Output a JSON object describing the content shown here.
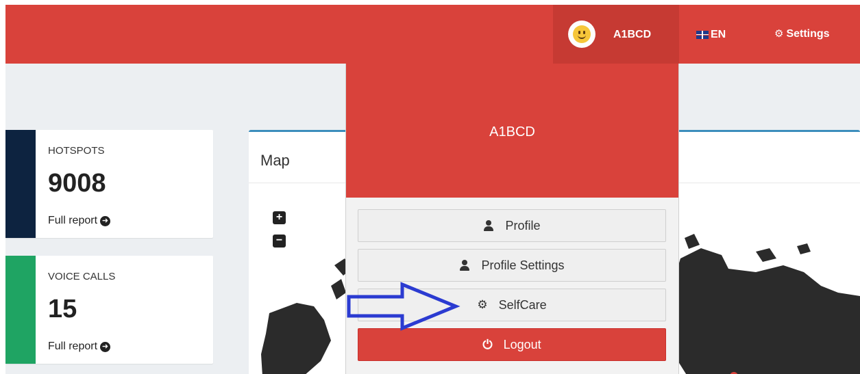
{
  "topbar": {
    "username": "A1BCD",
    "language": "EN",
    "settings_label": "Settings",
    "colors": {
      "bar": "#d9423b",
      "user_bg": "#c63a33"
    },
    "icons": [
      "avatar-smiley-icon",
      "uk-flag-icon",
      "gears-icon"
    ]
  },
  "cards": [
    {
      "title": "HOTSPOTS",
      "value": "9008",
      "link": "Full report",
      "strip_color": "#0d2340",
      "icon": "arrow-circle-right-icon"
    },
    {
      "title": "VOICE CALLS",
      "value": "15",
      "link": "Full report",
      "strip_color": "#1fa463",
      "icon": "arrow-circle-right-icon"
    }
  ],
  "map": {
    "title": "Map",
    "zoom_in": "+",
    "zoom_out": "−"
  },
  "dropdown": {
    "name": "A1BCD",
    "items": [
      {
        "label": "Profile",
        "icon": "user-icon"
      },
      {
        "label": "Profile Settings",
        "icon": "user-icon"
      },
      {
        "label": "SelfCare",
        "icon": "gear-icon"
      },
      {
        "label": "Logout",
        "icon": "power-icon"
      }
    ],
    "logout_color": "#d9423b"
  },
  "annotation": {
    "color": "#2b3bd1",
    "icon": "pointer-arrow-icon"
  }
}
